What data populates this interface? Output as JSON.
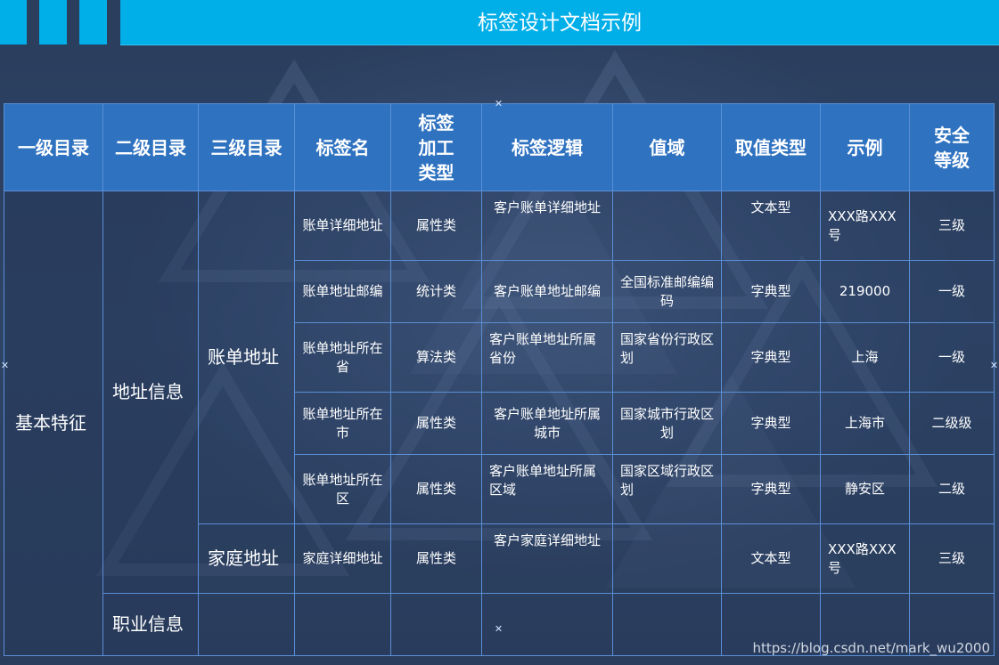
{
  "document": {
    "title": "标签设计文档示例",
    "watermark": "https://blog.csdn.net/mark_wu2000"
  },
  "colors": {
    "title_bar": "#00aee8",
    "header_bg": "#2f72c0",
    "page_bg": "#2b3e5e",
    "border": "#5a8fd6"
  },
  "table": {
    "headers": [
      "一级目录",
      "二级目录",
      "三级目录",
      "标签名",
      "标签加工类型",
      "标签逻辑",
      "值域",
      "取值类型",
      "示例",
      "安全等级"
    ],
    "header_lines": {
      "col5": [
        "标签",
        "加工",
        "类型"
      ],
      "col10": [
        "安全",
        "等级"
      ]
    },
    "level1": "基本特征",
    "level2": [
      "地址信息",
      "职业信息"
    ],
    "level3": [
      "账单地址",
      "家庭地址"
    ],
    "rows": [
      {
        "name": "账单详细地址",
        "type": "属性类",
        "logic": "客户账单详细地址",
        "domain": "",
        "value_type": "文本型",
        "example": "XXX路XXX号",
        "security": "三级"
      },
      {
        "name": "账单地址邮编",
        "type": "统计类",
        "logic": "客户账单地址邮编",
        "domain": "全国标准邮编编码",
        "value_type": "字典型",
        "example": "219000",
        "security": "一级"
      },
      {
        "name": "账单地址所在省",
        "type": "算法类",
        "logic": "客户账单地址所属省份",
        "domain": "国家省份行政区划",
        "value_type": "字典型",
        "example": "上海",
        "security": "一级"
      },
      {
        "name": "账单地址所在市",
        "type": "属性类",
        "logic": "客户账单地址所属城市",
        "domain": "国家城市行政区划",
        "value_type": "字典型",
        "example": "上海市",
        "security": "二级级"
      },
      {
        "name": "账单地址所在区",
        "type": "属性类",
        "logic": "客户账单地址所属区域",
        "domain": "国家区域行政区划",
        "value_type": "字典型",
        "example": "静安区",
        "security": "二级"
      },
      {
        "name": "家庭详细地址",
        "type": "属性类",
        "logic": "客户家庭详细地址",
        "domain": "",
        "value_type": "文本型",
        "example": "XXX路XXX号",
        "security": "三级"
      }
    ]
  }
}
